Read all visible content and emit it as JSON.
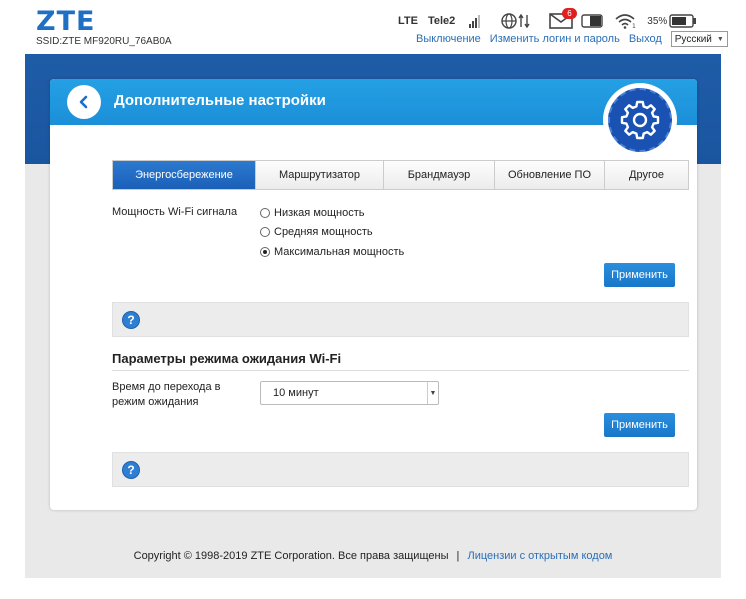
{
  "header": {
    "logo": "ZTE",
    "ssid": "SSID:ZTE MF920RU_76AB0A",
    "network_type": "LTE",
    "operator": "Tele2",
    "sms_count": "6",
    "battery_percent": "35%",
    "links": {
      "logout_disconnect": "Выключение",
      "change_login": "Изменить логин и пароль",
      "logout": "Выход"
    },
    "language": "Русский"
  },
  "page": {
    "title": "Дополнительные настройки"
  },
  "tabs": [
    {
      "label": "Энергосбережение",
      "active": true
    },
    {
      "label": "Маршрутизатор",
      "active": false
    },
    {
      "label": "Брандмауэр",
      "active": false
    },
    {
      "label": "Обновление ПО",
      "active": false
    },
    {
      "label": "Другое",
      "active": false
    }
  ],
  "wifi_power": {
    "label": "Мощность Wi-Fi сигнала",
    "options": [
      {
        "label": "Низкая мощность",
        "selected": false
      },
      {
        "label": "Средняя мощность",
        "selected": false
      },
      {
        "label": "Максимальная мощность",
        "selected": true
      }
    ],
    "apply_label": "Применить"
  },
  "standby": {
    "title": "Параметры режима ожидания Wi-Fi",
    "label_line1": "Время до перехода в",
    "label_line2": "режим ожидания",
    "selected_value": "10 минут",
    "apply_label": "Применить"
  },
  "help_icon_text": "?",
  "footer": {
    "copyright": "Copyright © 1998-2019 ZTE Corporation. Все права защищены",
    "separator": "|",
    "licenses_link": "Лицензии с открытым кодом"
  },
  "colors": {
    "brand_blue": "#1f6fc4",
    "header_blue": "#1b8fd8",
    "tab_active": "#1b5fb8",
    "sms_badge": "#e02020"
  }
}
